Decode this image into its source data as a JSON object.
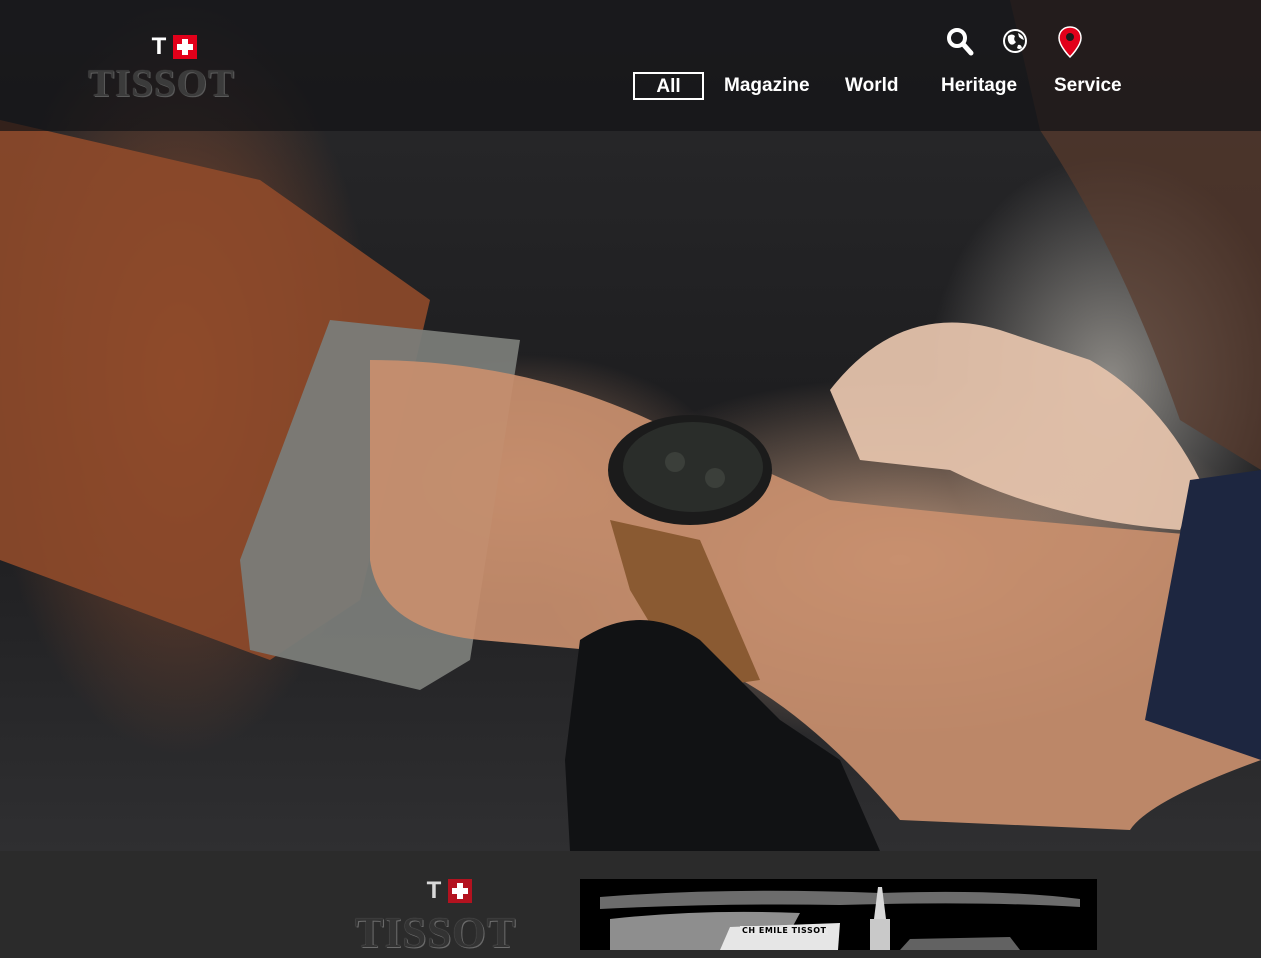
{
  "brand": {
    "logo_mark_letter": "T",
    "logo_wordmark": "TISSOT",
    "logo_red": "#e2001a"
  },
  "header": {
    "icons": [
      "search-icon",
      "globe-icon",
      "location-pin-icon"
    ],
    "nav": [
      {
        "label": "All",
        "active": true
      },
      {
        "label": "Magazine",
        "active": false
      },
      {
        "label": "World",
        "active": false
      },
      {
        "label": "Heritage",
        "active": false
      },
      {
        "label": "Service",
        "active": false
      }
    ]
  },
  "hero": {
    "content": "photo of a watch being fastened on a wrist"
  },
  "footer": {
    "logo_mark_letter": "T",
    "logo_wordmark": "TISSOT",
    "engraving_sign": "CH EMILE TISSOT"
  }
}
